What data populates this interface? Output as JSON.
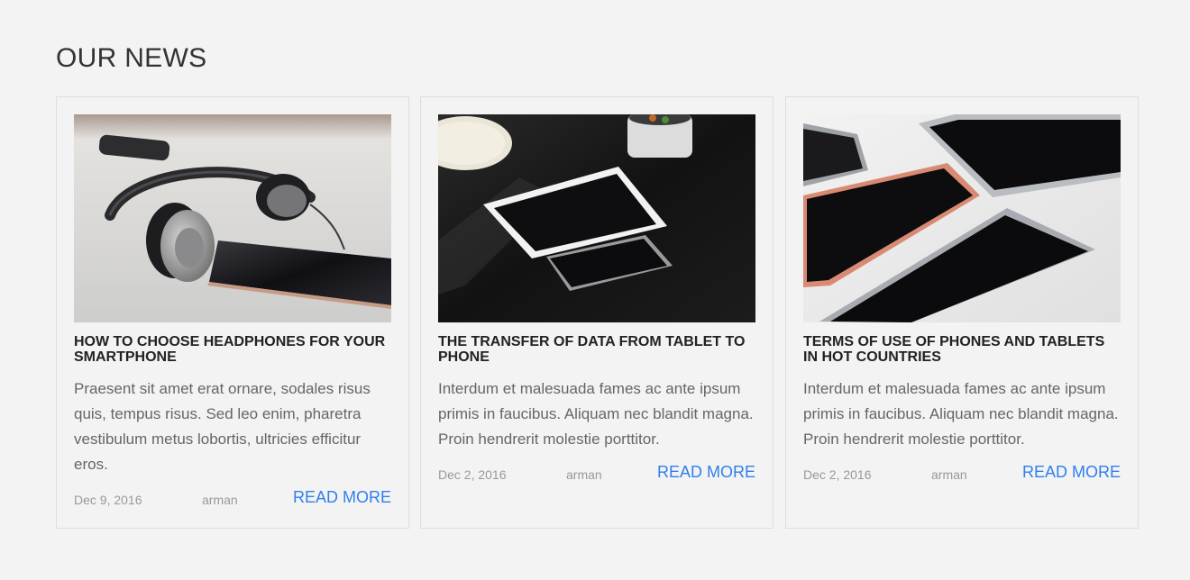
{
  "section": {
    "title": "OUR NEWS"
  },
  "posts": [
    {
      "title": "HOW TO CHOOSE HEADPHONES FOR YOUR SMARTPHONE",
      "excerpt": "Praesent sit amet erat ornare, sodales risus quis, tempus risus. Sed leo enim, pharetra vestibulum metus lobortis, ultricies efficitur eros.",
      "date": "Dec 9, 2016",
      "author": "arman",
      "read_more": "READ MORE",
      "image": "headphones-and-smartphone-photo"
    },
    {
      "title": "THE TRANSFER OF DATA FROM TABLET TO PHONE",
      "excerpt": "Interdum et malesuada fames ac ante ipsum primis in faucibus. Aliquam nec blandit magna. Proin hendrerit molestie porttitor.",
      "date": "Dec 2, 2016",
      "author": "arman",
      "read_more": "READ MORE",
      "image": "tablet-and-phone-on-dark-desk-photo"
    },
    {
      "title": "TERMS OF USE OF PHONES AND TABLETS IN HOT COUNTRIES",
      "excerpt": "Interdum et malesuada fames ac ante ipsum primis in faucibus. Aliquam nec blandit magna. Proin hendrerit molestie porttitor.",
      "date": "Dec 2, 2016",
      "author": "arman",
      "read_more": "READ MORE",
      "image": "phones-and-tablets-on-white-desk-photo"
    }
  ],
  "colors": {
    "background": "#f3f3f3",
    "link": "#2f80ed",
    "border": "#dedede"
  }
}
